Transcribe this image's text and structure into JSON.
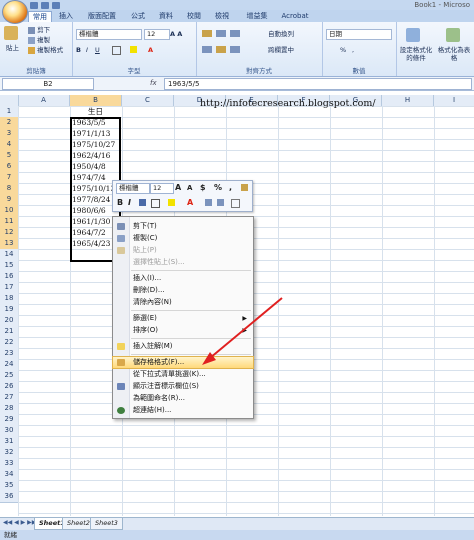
{
  "window": {
    "title": "Book1 - Microso"
  },
  "tabs": [
    "常用",
    "插入",
    "版面配置",
    "公式",
    "資料",
    "校閱",
    "檢視",
    "增益集",
    "Acrobat"
  ],
  "ribbon": {
    "clipboard": {
      "label": "剪貼簿",
      "paste": "貼上",
      "cut": "剪下",
      "copy": "複製",
      "format_painter": "複製格式"
    },
    "font": {
      "label": "字型",
      "name": "標楷體",
      "size": "12"
    },
    "alignment": {
      "label": "對齊方式",
      "wrap": "自動換列",
      "merge": "跨欄置中"
    },
    "number": {
      "label": "數值",
      "format": "日期",
      "percent": "%",
      "comma": ","
    },
    "styles": {
      "conditional": "設定格式化的條件",
      "table": "格式化為表格"
    }
  },
  "formula_bar": {
    "name_box": "B2",
    "fx": "fx",
    "content": "1963/5/5"
  },
  "grid": {
    "columns": [
      "A",
      "B",
      "C",
      "D",
      "E",
      "F",
      "G",
      "H",
      "I"
    ],
    "rows": [
      "1",
      "2",
      "3",
      "4",
      "5",
      "6",
      "7",
      "8",
      "9",
      "10",
      "11",
      "12",
      "13",
      "14",
      "15",
      "16",
      "17",
      "18",
      "19",
      "20",
      "21",
      "22",
      "23",
      "24",
      "25",
      "26",
      "27",
      "28",
      "29",
      "30",
      "31",
      "32",
      "33",
      "34",
      "35",
      "36"
    ],
    "header_cell": "生日",
    "dates": [
      "1963/5/5",
      "1971/1/13",
      "1975/10/27",
      "1962/4/16",
      "1950/4/8",
      "1974/7/4",
      "1975/10/13",
      "1977/8/24",
      "1980/6/6",
      "1961/1/30",
      "1964/7/2",
      "1965/4/23"
    ]
  },
  "url_text": "http://infotecresearch.blogspot.com/",
  "mini_toolbar": {
    "font": "標楷體",
    "size": "12",
    "a_big": "A",
    "a_small": "A",
    "currency": "$",
    "percent": "%",
    "comma": ",",
    "bold": "B",
    "italic": "I",
    "font_color": "A"
  },
  "context_menu": {
    "items": [
      {
        "label": "剪下(T)",
        "enabled": true
      },
      {
        "label": "複製(C)",
        "enabled": true
      },
      {
        "label": "貼上(P)",
        "enabled": false
      },
      {
        "label": "選擇性貼上(S)...",
        "enabled": false
      },
      {
        "label": "插入(I)...",
        "enabled": true
      },
      {
        "label": "刪除(D)...",
        "enabled": true
      },
      {
        "label": "清除內容(N)",
        "enabled": true
      },
      {
        "label": "篩選(E)",
        "enabled": true
      },
      {
        "label": "排序(O)",
        "enabled": true
      },
      {
        "label": "插入註解(M)",
        "enabled": true
      },
      {
        "label": "儲存格格式(F)...",
        "enabled": true
      },
      {
        "label": "從下拉式清單挑選(K)...",
        "enabled": true
      },
      {
        "label": "顯示注音標示欄位(S)",
        "enabled": true
      },
      {
        "label": "為範圍命名(R)...",
        "enabled": true
      },
      {
        "label": "超連結(H)...",
        "enabled": true
      }
    ]
  },
  "sheets": [
    "Sheet1",
    "Sheet2",
    "Sheet3"
  ],
  "status": "就緒",
  "colors": {
    "ribbon": "#dbe8f7",
    "selected_header": "#f9d99b",
    "highlight": "#ffd97a",
    "arrow": "#e02020"
  }
}
